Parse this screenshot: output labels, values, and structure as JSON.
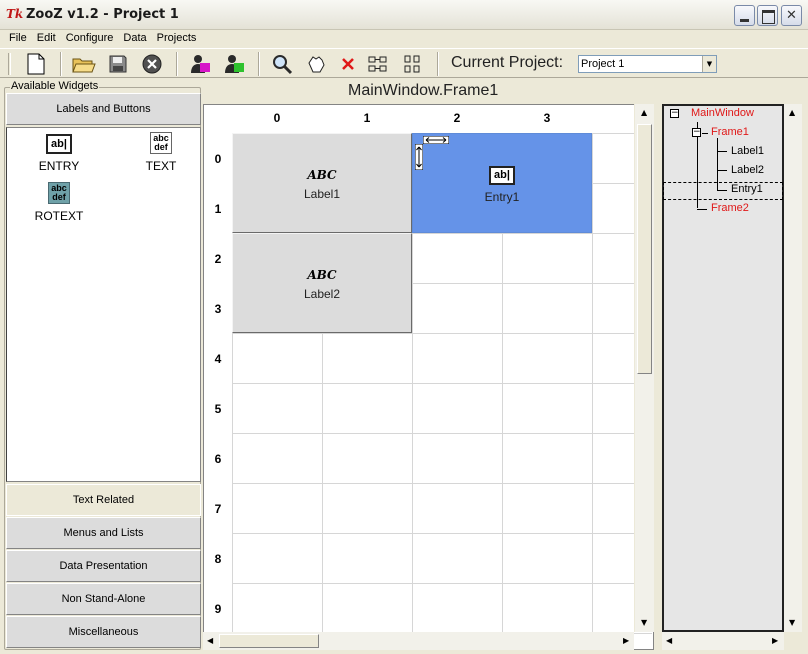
{
  "window": {
    "logo_text": "Tk",
    "title": "ZooZ v1.2 - Project 1"
  },
  "menubar": {
    "items": [
      "File",
      "Edit",
      "Configure",
      "Data",
      "Projects"
    ]
  },
  "toolbar": {
    "buttons": [
      "new-file",
      "open-folder",
      "save-floppy",
      "close-circle",
      "run-user-1",
      "run-user-2",
      "search-magnifier",
      "hand-tool",
      "delete-x",
      "layout-horizontal",
      "layout-grid"
    ],
    "current_project_label": "Current Project:",
    "current_project_value": "Project 1"
  },
  "left_panel": {
    "group_label": "Available Widgets",
    "top_category": "Labels and Buttons",
    "widgets": [
      {
        "name": "ENTRY",
        "icon_text": "ab|"
      },
      {
        "name": "TEXT",
        "icon_text": "abc def"
      },
      {
        "name": "ROTEXT",
        "icon_text": "abc def"
      }
    ],
    "bottom_categories": [
      "Text Related",
      "Menus and Lists",
      "Data Presentation",
      "Non Stand-Alone",
      "Miscellaneous"
    ]
  },
  "canvas": {
    "title": "MainWindow.Frame1",
    "col_headers": [
      "0",
      "1",
      "2",
      "3"
    ],
    "row_headers": [
      "0",
      "1",
      "2",
      "3",
      "4",
      "5",
      "6",
      "7",
      "8",
      "9"
    ],
    "widgets": [
      {
        "name": "Label1",
        "icon_text": "ABC",
        "kind": "label"
      },
      {
        "name": "Entry1",
        "icon_text": "ab|",
        "kind": "entry"
      },
      {
        "name": "Label2",
        "icon_text": "ABC",
        "kind": "label"
      }
    ]
  },
  "tree": {
    "root": "MainWindow",
    "frame1": "Frame1",
    "children": [
      "Label1",
      "Label2",
      "Entry1"
    ],
    "frame2": "Frame2",
    "expand_glyph": "−"
  },
  "colors": {
    "tree_frame_text": "#e01818",
    "selected_widget_bg": "#6593e8",
    "label_widget_bg": "#dcdcdc"
  }
}
